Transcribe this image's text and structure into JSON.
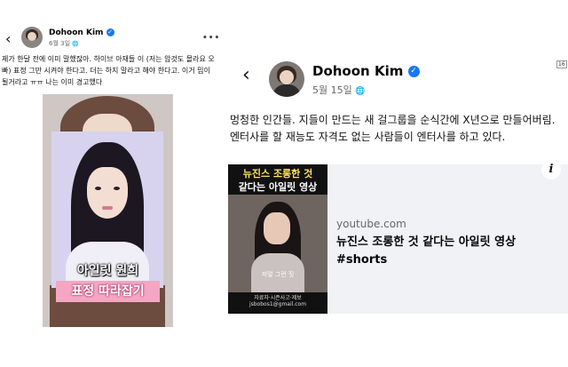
{
  "left_post": {
    "author": "Dohoon Kim",
    "date": "6월 3일",
    "text": "제가 한달 전에 이미 말했잖아. 하이브 아재들 이 (저는 암것도 몰라요 오빠) 표정 그만 시켜야 한다고. 더는 하지 말라고 해야 한다고. 이거 밈이 될거라고 ㅠㅠ 나는 이미 경고했다",
    "media_caption_1": "아일릿 원희",
    "media_caption_2": "표정 따라잡기"
  },
  "right_post": {
    "author": "Dohoon Kim",
    "date": "5월 15일",
    "text": "멍청한 인간들. 지들이 만드는 새 걸그룹을 순식간에 X년으로 만들어버림. 엔터사를 할 재능도 자격도 없는 사람들이 엔터사를 하고 있다.",
    "link": {
      "thumb_title_1": "뉴진스 조롱한 것",
      "thumb_title_2": "같다는 아일릿 영상",
      "thumb_subtitle": "저렇 그런 짓",
      "thumb_footer_1": "자료자·시즌사고·제보",
      "thumb_footer_2": "jsbobos1@gmail.com",
      "domain": "youtube.com",
      "title": "뉴진스 조롱한 것 같다는 아일릿 영상 #shorts"
    }
  },
  "icons": {
    "back": "‹",
    "verified": "✓",
    "globe": "🌐",
    "more": "•••",
    "info": "i"
  },
  "corner_badge": "16",
  "colors": {
    "verified": "#1877f2",
    "muted": "#65676b",
    "card_bg": "#f0f2f5"
  }
}
